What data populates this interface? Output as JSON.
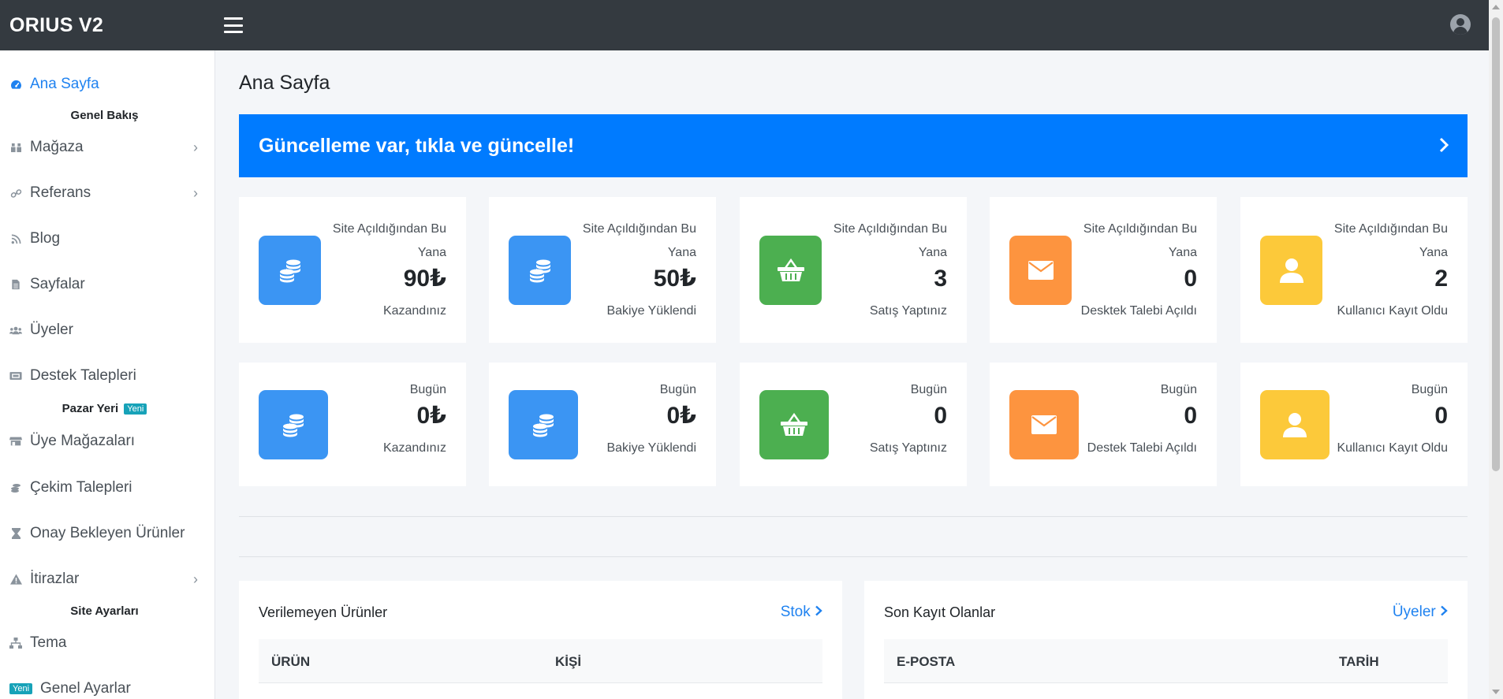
{
  "app": {
    "brand": "ORIUS V2"
  },
  "sidebar": {
    "items": [
      {
        "label": "Ana Sayfa",
        "icon": "tachometer-icon"
      },
      {
        "label": "Mağaza",
        "icon": "store-icon"
      },
      {
        "label": "Referans",
        "icon": "link-icon"
      },
      {
        "label": "Blog",
        "icon": "rss-icon"
      },
      {
        "label": "Sayfalar",
        "icon": "file-icon"
      },
      {
        "label": "Üyeler",
        "icon": "users-icon"
      },
      {
        "label": "Destek Talepleri",
        "icon": "ticket-icon"
      },
      {
        "label": "Üye Mağazaları",
        "icon": "shop-icon"
      },
      {
        "label": "Çekim Talepleri",
        "icon": "coins-icon"
      },
      {
        "label": "Onay Bekleyen Ürünler",
        "icon": "hourglass-icon"
      },
      {
        "label": "İtirazlar",
        "icon": "warning-icon"
      },
      {
        "label": "Tema",
        "icon": "sitemap-icon"
      },
      {
        "label": "Genel Ayarlar",
        "badge": "Yeni"
      }
    ],
    "headers": {
      "overview": "Genel Bakış",
      "marketplace": "Pazar Yeri",
      "marketplace_badge": "Yeni",
      "site_settings": "Site Ayarları"
    }
  },
  "main": {
    "title": "Ana Sayfa",
    "banner": "Güncelleme var, tıkla ve güncelle!",
    "total_stats": [
      {
        "top1": "Site Açıldığından Bu",
        "top2": "Yana",
        "value": "90₺",
        "label": "Kazandınız",
        "icon": "coins-icon",
        "color": "#3b95f3"
      },
      {
        "top1": "Site Açıldığından Bu",
        "top2": "Yana",
        "value": "50₺",
        "label": "Bakiye Yüklendi",
        "icon": "coins-icon",
        "color": "#3b95f3"
      },
      {
        "top1": "Site Açıldığından Bu",
        "top2": "Yana",
        "value": "3",
        "label": "Satış Yaptınız",
        "icon": "basket-icon",
        "color": "#4caf50"
      },
      {
        "top1": "Site Açıldığından Bu",
        "top2": "Yana",
        "value": "0",
        "label": "Desktek Talebi Açıldı",
        "icon": "envelope-icon",
        "color": "#fd943f"
      },
      {
        "top1": "Site Açıldığından Bu",
        "top2": "Yana",
        "value": "2",
        "label": "Kullanıcı Kayıt Oldu",
        "icon": "user-icon",
        "color": "#fcc93a"
      }
    ],
    "today_stats": [
      {
        "top": "Bugün",
        "value": "0₺",
        "label": "Kazandınız",
        "icon": "coins-icon",
        "color": "#3b95f3"
      },
      {
        "top": "Bugün",
        "value": "0₺",
        "label": "Bakiye Yüklendi",
        "icon": "coins-icon",
        "color": "#3b95f3"
      },
      {
        "top": "Bugün",
        "value": "0",
        "label": "Satış Yaptınız",
        "icon": "basket-icon",
        "color": "#4caf50"
      },
      {
        "top": "Bugün",
        "value": "0",
        "label": "Destek Talebi Açıldı",
        "icon": "envelope-icon",
        "color": "#fd943f"
      },
      {
        "top": "Bugün",
        "value": "0",
        "label": "Kullanıcı Kayıt Oldu",
        "icon": "user-icon",
        "color": "#fcc93a"
      }
    ],
    "undelivered": {
      "title": "Verilemeyen Ürünler",
      "link": "Stok",
      "columns": [
        "ÜRÜN",
        "KİŞİ"
      ]
    },
    "recent_signups": {
      "title": "Son Kayıt Olanlar",
      "link": "Üyeler",
      "columns": [
        "E-POSTA",
        "TARİH"
      ]
    }
  }
}
